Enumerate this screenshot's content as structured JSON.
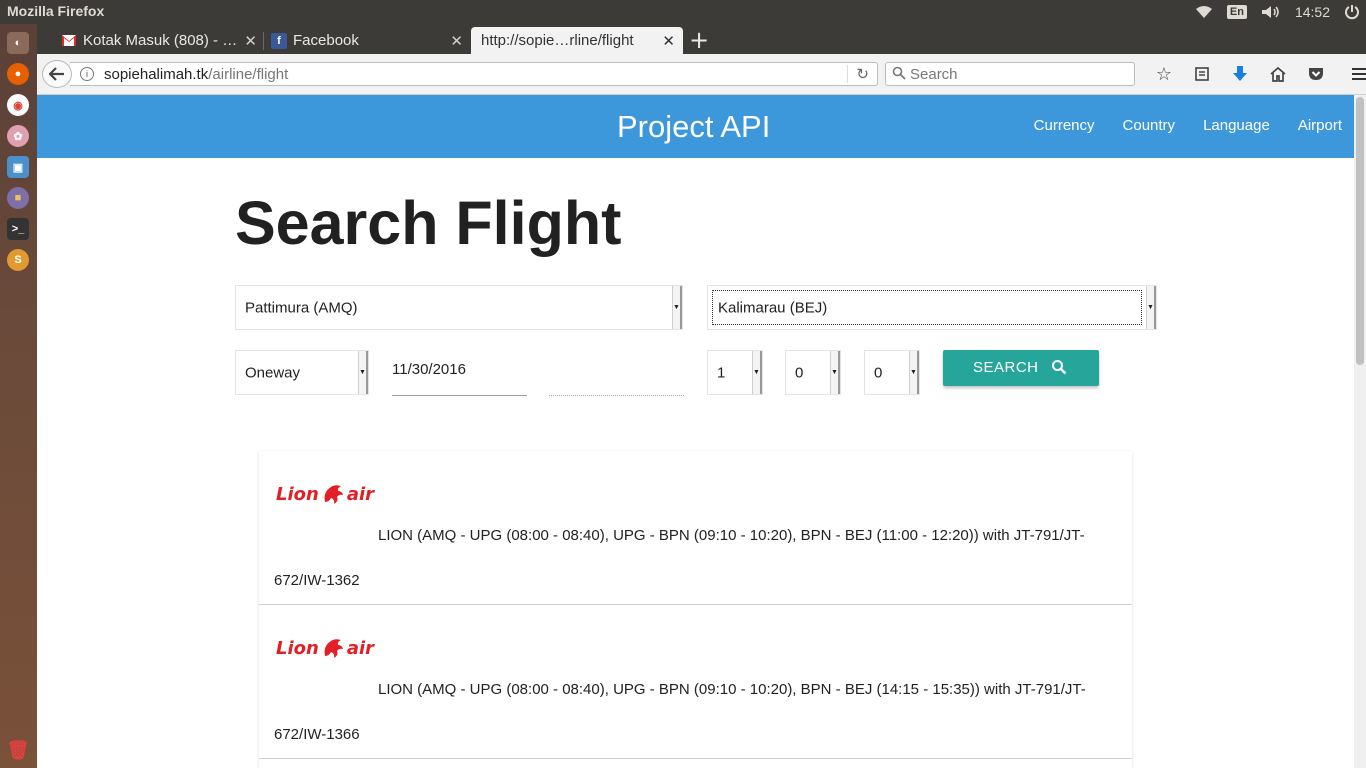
{
  "os": {
    "app_title": "Mozilla Firefox",
    "keyboard_layout": "En",
    "clock": "14:52"
  },
  "browser": {
    "tabs": [
      {
        "label": "Kotak Masuk (808) - …",
        "icon": "gmail-icon"
      },
      {
        "label": "Facebook",
        "icon": "facebook-icon"
      },
      {
        "label": "http://sopie…rline/flight",
        "icon": "none",
        "active": true
      }
    ],
    "url_host": "sopiehalimah.tk",
    "url_path": "/airline/flight",
    "search_placeholder": "Search"
  },
  "site": {
    "brand": "Project API",
    "menu": [
      "Currency",
      "Country",
      "Language",
      "Airport"
    ]
  },
  "form": {
    "title": "Search Flight",
    "origin": "Pattimura (AMQ)",
    "destination": "Kalimarau (BEJ)",
    "trip_type": "Oneway",
    "depart_date": "11/30/2016",
    "return_date": "",
    "adults": "1",
    "children": "0",
    "infants": "0",
    "search_label": "SEARCH"
  },
  "results": [
    {
      "airline_logo_text": "Lion air",
      "line1": "LION (AMQ - UPG (08:00 - 08:40), UPG - BPN (09:10 - 10:20), BPN - BEJ (11:00 - 12:20)) with JT-791/JT-",
      "line2": "672/IW-1362"
    },
    {
      "airline_logo_text": "Lion air",
      "line1": "LION (AMQ - UPG (08:00 - 08:40), UPG - BPN (09:10 - 10:20), BPN - BEJ (14:15 - 15:35)) with JT-791/JT-",
      "line2": "672/IW-1366"
    }
  ],
  "colors": {
    "header": "#3c98db",
    "search_button": "#26a69a",
    "lion_red": "#e31e24"
  }
}
